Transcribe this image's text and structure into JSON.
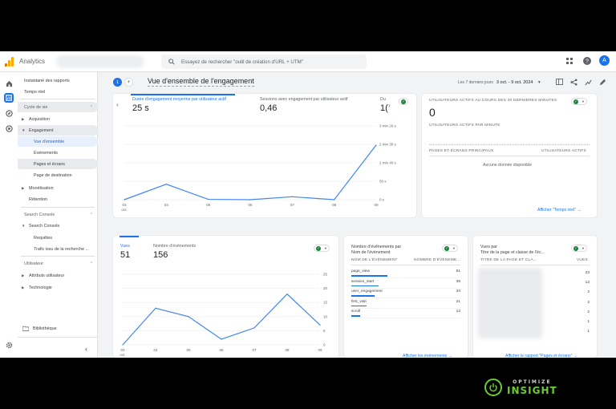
{
  "topbar": {
    "app_name": "Analytics",
    "search_placeholder": "Essayez de rechercher \"outil de création d'URL + UTM\"",
    "avatar_letter": "A"
  },
  "nav": {
    "items": [
      {
        "label": "Instantané des rapports"
      },
      {
        "label": "Temps réel"
      },
      {
        "label": "Cycle de vie"
      },
      {
        "label": "Acquisition"
      },
      {
        "label": "Engagement"
      },
      {
        "label": "Vue d'ensemble"
      },
      {
        "label": "Événements"
      },
      {
        "label": "Pages et écrans"
      },
      {
        "label": "Page de destination"
      },
      {
        "label": "Monétisation"
      },
      {
        "label": "Rétention"
      },
      {
        "label": "Search Console"
      },
      {
        "label": "Search Console"
      },
      {
        "label": "Requêtes"
      },
      {
        "label": "Trafic issu de la recherche ..."
      },
      {
        "label": "Utilisateur"
      },
      {
        "label": "Attributs utilisateur"
      },
      {
        "label": "Technologie"
      }
    ],
    "library": "Bibliothèque"
  },
  "header": {
    "badge": "1",
    "plus": "+",
    "title": "Vue d'ensemble de l'engagement",
    "date_label": "Les 7 derniers jours",
    "date_range": "3 oct. - 9 oct. 2024"
  },
  "engagement_card": {
    "metrics": [
      {
        "label": "Durée d'engagement moyenne par utilisateur actif",
        "value": "25 s"
      },
      {
        "label": "Sessions avec engagement par utilisateur actif",
        "value": "0,46"
      },
      {
        "label": "Du",
        "value": "1("
      }
    ],
    "y_ticks": [
      "3 min 20 s",
      "2 min 30 s",
      "1 min 40 s",
      "50 s",
      "0 s"
    ],
    "x_ticks": [
      "03",
      "04",
      "05",
      "06",
      "07",
      "08",
      "09"
    ],
    "x_sub": "oct."
  },
  "realtime_card": {
    "title": "UTILISATEURS ACTIFS AU COURS DES 30 DERNIÈRES MINUTES",
    "value": "0",
    "per_minute": "UTILISATEURS ACTIFS PAR MINUTE",
    "col1": "PAGES ET ÉCRANS PRINCIPAUX",
    "col2": "UTILISATEURS ACTIFS",
    "empty": "Aucune donnée disponible",
    "link": "Afficher \"Temps réel\""
  },
  "views_card": {
    "metrics": [
      {
        "label": "Vues",
        "value": "51"
      },
      {
        "label": "Nombre d'événements",
        "value": "156"
      }
    ],
    "y_ticks": [
      "25",
      "20",
      "15",
      "10",
      "5",
      "0"
    ],
    "x_ticks": [
      "03",
      "04",
      "05",
      "06",
      "07",
      "08",
      "09"
    ],
    "x_sub": "oct."
  },
  "events_card": {
    "title_line1": "Nombre d'événements par",
    "title_line2": "Nom de l'événement",
    "col1": "NOM DE L'ÉVÉNEMENT",
    "col2": "NOMBRE D'ÉVÉNEME...",
    "rows": [
      {
        "name": "page_view",
        "count": "51"
      },
      {
        "name": "session_start",
        "count": "38"
      },
      {
        "name": "user_engagement",
        "count": "33"
      },
      {
        "name": "first_visit",
        "count": "21"
      },
      {
        "name": "scroll",
        "count": "13"
      }
    ],
    "link": "Afficher les événements"
  },
  "pages_card": {
    "title_line1": "Vues par",
    "title_line2": "Titre de la page et classe de l'éc...",
    "col1": "TITRE DE LA PAGE ET CLA...",
    "col2": "VUES",
    "counts": [
      "23",
      "12",
      "2",
      "2",
      "2",
      "1",
      "1"
    ],
    "link": "Afficher le rapport \"Pages et écrans\""
  },
  "chart_data": [
    {
      "type": "line",
      "x": [
        "03",
        "04",
        "05",
        "06",
        "07",
        "08",
        "09"
      ],
      "series": [
        {
          "values": [
            0,
            42,
            1,
            0,
            8,
            0,
            148
          ]
        }
      ],
      "ylabel": "",
      "yticks": [
        "0 s",
        "50 s",
        "1 min 40 s",
        "2 min 30 s",
        "3 min 20 s"
      ],
      "ylim": [
        0,
        200
      ],
      "grid": true
    },
    {
      "type": "line",
      "x": [
        "03",
        "04",
        "05",
        "06",
        "07",
        "08",
        "09"
      ],
      "series": [
        {
          "name": "Vues",
          "values": [
            0,
            13,
            10,
            2,
            6,
            18,
            7
          ]
        }
      ],
      "ylim": [
        0,
        25
      ],
      "grid": true
    }
  ],
  "colors": {
    "accent": "#1a73e8",
    "line": "#4285f4"
  },
  "watermark": {
    "top": "OPTIMIZE",
    "bottom": "INSIGHT"
  }
}
